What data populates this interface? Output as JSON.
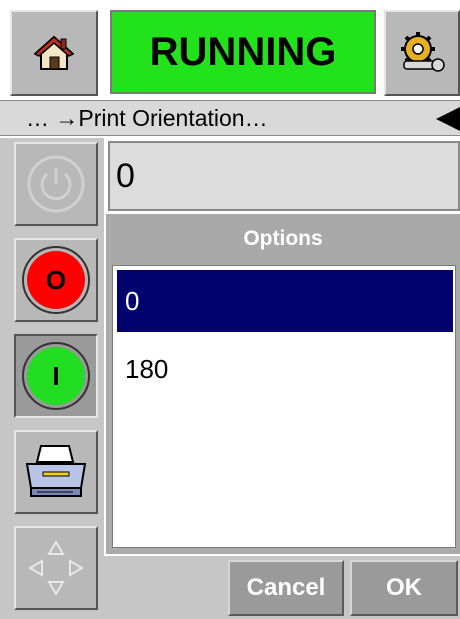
{
  "header": {
    "home_icon": "home-icon",
    "status_text": "RUNNING",
    "status_color": "#21e21b",
    "settings_icon": "gear-wrench-icon"
  },
  "breadcrumb": {
    "text": "… →Print Orientation…",
    "back_icon": "left-triangle-icon"
  },
  "sidebar": {
    "power_icon": "power-icon",
    "stop_label": "O",
    "stop_color": "#ff0000",
    "start_label": "I",
    "start_color": "#22dd22",
    "printer_icon": "printer-icon",
    "nav_icon": "arrows-icon"
  },
  "field": {
    "value": "0"
  },
  "options": {
    "title": "Options",
    "items": [
      "0",
      "180"
    ],
    "selected": "0"
  },
  "footer": {
    "cancel_label": "Cancel",
    "ok_label": "OK"
  }
}
